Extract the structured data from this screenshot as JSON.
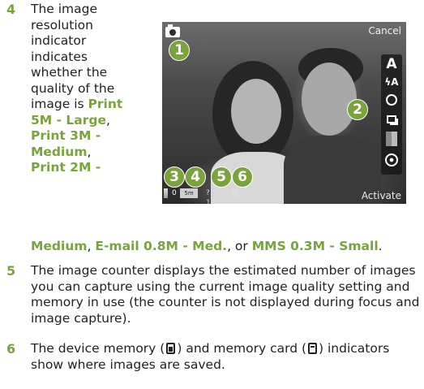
{
  "item4": {
    "number": "4",
    "lines": [
      "The image",
      "resolution",
      "indicator",
      "indicates",
      "whether the",
      "quality of the",
      "image is "
    ],
    "opt1_a": "Print",
    "opt1_b": "5M - Large",
    "sep1": ",",
    "opt2_a": "Print 3M -",
    "opt2_b": "Medium",
    "sep2": ",",
    "opt3_a": "Print 2M -",
    "cont_opt3_b": "Medium",
    "cont_sep3": ", ",
    "cont_opt4": "E-mail 0.8M - Med.",
    "cont_sep4": ", or ",
    "cont_opt5": "MMS 0.3M - Small",
    "cont_end": "."
  },
  "item5": {
    "number": "5",
    "text": "The image counter displays the estimated number of images you can capture using the current image quality setting and memory in use (the counter is not displayed during focus and image capture)."
  },
  "item6": {
    "number": "6",
    "text_a": "The device memory (",
    "text_b": ") and memory card (",
    "text_c": ") indicators show where images are saved."
  },
  "viewfinder": {
    "cancel": "Cancel",
    "activate": "Activate",
    "toolbar": {
      "scene": "A",
      "flash": "ϟA"
    },
    "callouts": [
      "1",
      "2",
      "3",
      "4",
      "5",
      "6"
    ],
    "status": {
      "zero": "0",
      "res": "5m",
      "count": "?115"
    }
  },
  "colors": {
    "accent": "#7aa33e",
    "text": "#222222"
  },
  "icons": [
    "camera-icon",
    "scene-icon",
    "flash-icon",
    "self-timer-icon",
    "sequence-icon",
    "exposure-icon",
    "settings-icon",
    "device-memory-icon",
    "memory-card-icon"
  ]
}
